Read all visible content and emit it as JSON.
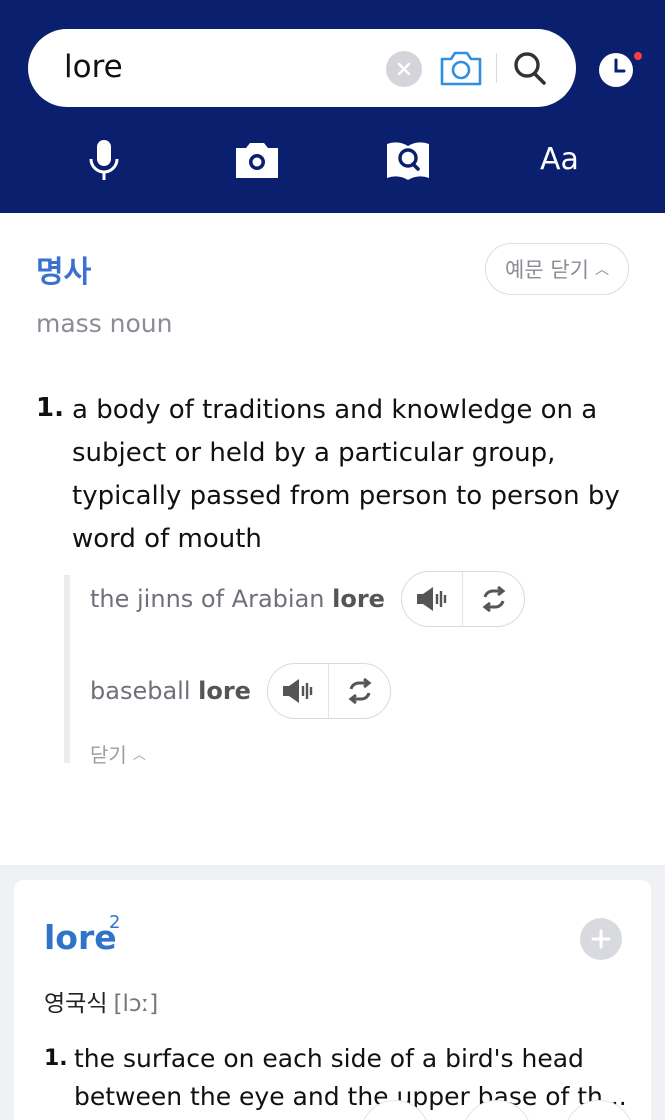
{
  "search": {
    "query": "lore"
  },
  "toolbar": {
    "font_label": "Aa"
  },
  "entry1": {
    "pos_ko": "명사",
    "pos_en": "mass noun",
    "toggle_examples_label": "예문 닫기",
    "definition_number": "1.",
    "definition": "a body of traditions and knowledge on a subject or held by a particular group, typically passed from person to person by word of mouth",
    "examples": [
      {
        "prefix": "the jinns of Arabian ",
        "keyword": "lore"
      },
      {
        "prefix": "baseball ",
        "keyword": "lore"
      }
    ],
    "close_label": "닫기"
  },
  "entry2": {
    "headword": "lore",
    "superscript": "2",
    "pron_label": "영국식",
    "ipa": "[lɔː]",
    "definition_number": "1.",
    "definition": "the surface on each side of a bird's head between the eye and the upper base of th..."
  },
  "colors": {
    "header_bg": "#0a1f6e",
    "accent_blue": "#3b6fd1",
    "headword_blue": "#2f74c9",
    "camera_blue": "#2f8fe0",
    "notification_red": "#ff3b3b"
  },
  "icons": [
    "clear-icon",
    "camera-icon",
    "search-icon",
    "history-clock-icon",
    "microphone-icon",
    "camera-tool-icon",
    "book-search-icon",
    "speaker-icon",
    "repeat-icon",
    "plus-icon"
  ]
}
